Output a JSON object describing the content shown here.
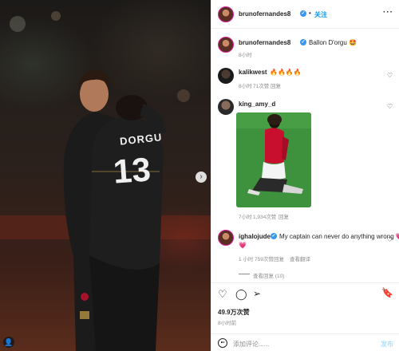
{
  "photo": {
    "jersey_name": "DORGU",
    "jersey_number": "13",
    "next_icon": "chevron-right-icon",
    "tag_icon": "user-tag-icon"
  },
  "header": {
    "username": "brunofernandes8",
    "separator": "•",
    "follow_label": "关注",
    "more_icon": "more-icon"
  },
  "caption": {
    "username": "brunofernandes8",
    "text": "Ballon D'orgu 🤩",
    "time": "8小时"
  },
  "comments": [
    {
      "username": "kalikwest",
      "text": "🔥🔥🔥🔥",
      "time": "8小时",
      "likes": "71次赞",
      "reply": "回复"
    },
    {
      "username": "king_amy_d",
      "text": "",
      "time": "7小时",
      "likes": "1,934次赞",
      "reply": "回复"
    },
    {
      "username": "ighalojude",
      "text": "My captain can never do anything wrong 💗💗",
      "text2": "💗",
      "time": "1 小时",
      "likes": "759次赞",
      "reply": "回复",
      "translate": "查看翻译",
      "view_replies": "查看回复 (10)"
    }
  ],
  "actions": {
    "like_icon": "heart-icon",
    "comment_icon": "comment-icon",
    "share_icon": "share-icon",
    "save_icon": "bookmark-icon",
    "likes_count": "49.9万次赞",
    "time": "8小时前"
  },
  "comment_box": {
    "placeholder": "添加评论......",
    "post_label": "发布"
  },
  "colors": {
    "link_blue": "#0095f6",
    "verified_blue": "#3897f0",
    "kit_red": "#c8102e"
  }
}
